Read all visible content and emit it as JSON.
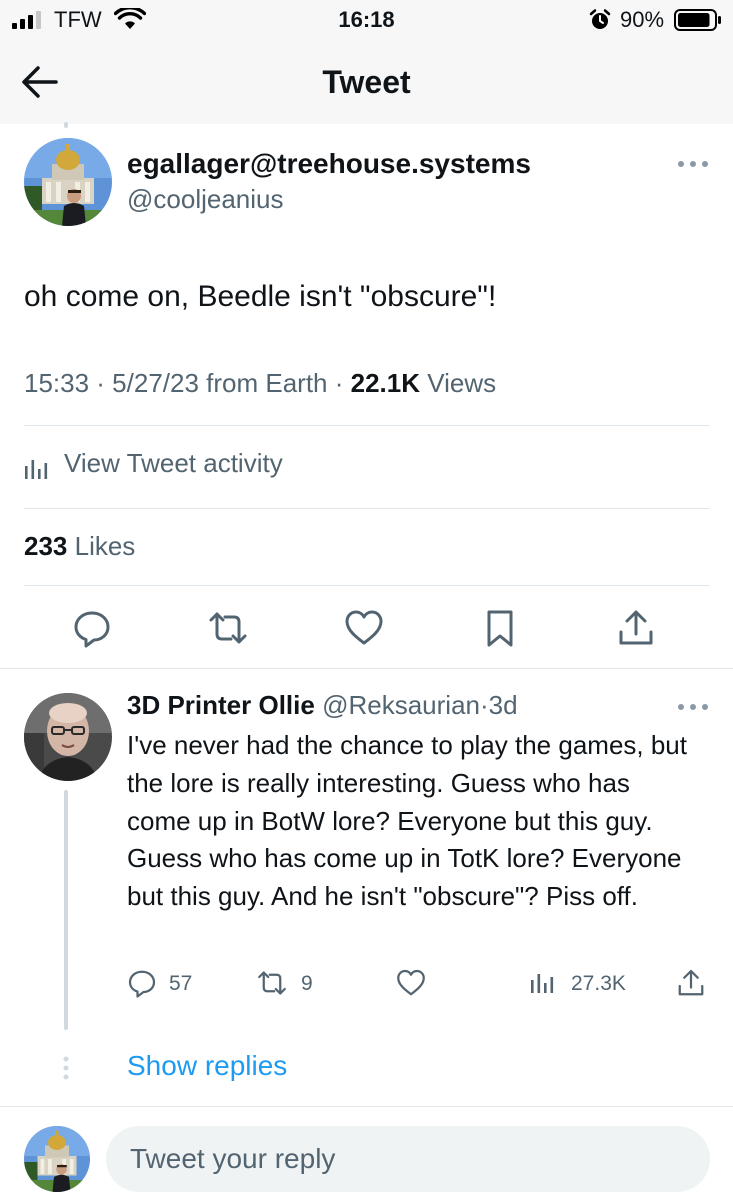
{
  "status_bar": {
    "carrier": "TFW",
    "time": "16:18",
    "battery_percent": "90%",
    "battery_level": 0.9,
    "signal_bars": 3,
    "icons": [
      "signal-icon",
      "wifi-icon",
      "alarm-icon",
      "battery-icon"
    ]
  },
  "nav": {
    "title": "Tweet",
    "back_icon": "back-arrow-icon"
  },
  "tweet": {
    "author_name": "egallager@treehouse.systems",
    "author_handle": "@cooljeanius",
    "text": "oh come on, Beedle isn't \"obscure\"!",
    "meta_prefix": "15:33 · 5/27/23 from Earth · ",
    "views_count": "22.1K",
    "views_label": " Views",
    "activity_label": "View Tweet activity",
    "likes_count": "233",
    "likes_label": " Likes",
    "actions": [
      "reply-icon",
      "retweet-icon",
      "like-icon",
      "bookmark-icon",
      "share-icon"
    ]
  },
  "reply": {
    "name": "3D Printer Ollie",
    "handle": "@Reksaurian",
    "separator": "·",
    "time": "3d",
    "text": "I've never had the chance to play the games, but the lore is really interesting. Guess who has come up in BotW lore? Everyone but this guy. Guess who has come up in TotK lore? Everyone but this guy. And he isn't \"obscure\"? Piss off.",
    "reply_count": "57",
    "retweet_count": "9",
    "views_count": "27.3K"
  },
  "show_replies": "Show replies",
  "compose": {
    "placeholder": "Tweet your reply"
  },
  "colors": {
    "accent": "#1d9bf0",
    "text_primary": "#0f1419",
    "text_secondary": "#536471",
    "divider": "#e1e8ed"
  }
}
